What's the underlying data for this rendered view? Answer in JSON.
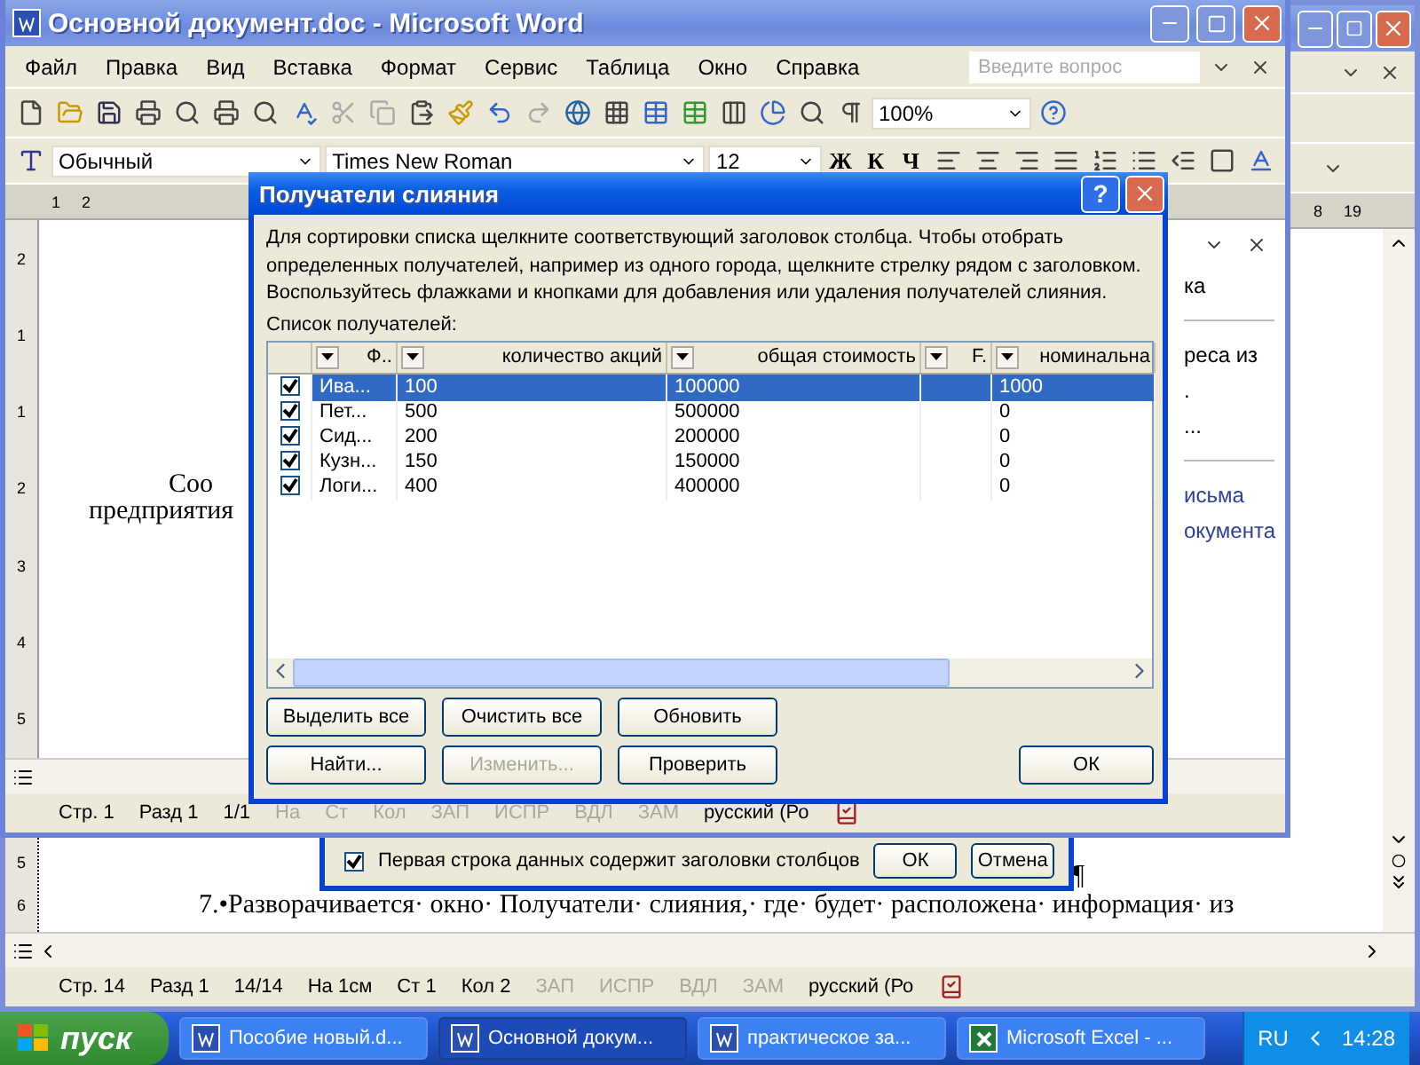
{
  "back_window": {
    "ruler_numbers": [
      "8",
      "19"
    ],
    "vruler_numbers": [
      "5",
      "6"
    ],
    "pilcrow": "¶",
    "paragraph": "7.•Разворачивается· окно· Получатели· слияния,· где· будет· расположена· информация· из",
    "status_bar": [
      {
        "text": "Стр. 14",
        "disabled": false
      },
      {
        "text": "Разд 1",
        "disabled": false
      },
      {
        "text": "14/14",
        "disabled": false
      },
      {
        "text": "На 1см",
        "disabled": false
      },
      {
        "text": "Ст 1",
        "disabled": false
      },
      {
        "text": "Кол 2",
        "disabled": false
      },
      {
        "text": "ЗАП",
        "disabled": true
      },
      {
        "text": "ИСПР",
        "disabled": true
      },
      {
        "text": "ВДЛ",
        "disabled": true
      },
      {
        "text": "ЗАМ",
        "disabled": true
      },
      {
        "text": "русский (Ро",
        "disabled": false
      }
    ]
  },
  "back_dialog": {
    "checkbox_label": "Первая строка данных содержит заголовки столбцов",
    "checked": true,
    "buttons": [
      "ОК",
      "Отмена"
    ]
  },
  "window": {
    "title": "Основной документ.doc - Microsoft Word",
    "menu": [
      "Файл",
      "Правка",
      "Вид",
      "Вставка",
      "Формат",
      "Сервис",
      "Таблица",
      "Окно",
      "Справка"
    ],
    "help_placeholder": "Введите вопрос",
    "zoom": "100%",
    "style": "Обычный",
    "font": "Times New Roman",
    "size": "12",
    "format_buttons": [
      "Ж",
      "К",
      "Ч"
    ],
    "ruler_numbers": [
      "1",
      "2"
    ],
    "vruler_numbers": [
      "2",
      "1",
      "1",
      "2",
      "3",
      "4",
      "5"
    ],
    "document_lines": [
      "Соо",
      "предприятия"
    ],
    "task_pane": [
      {
        "text": "ка",
        "kind": "text"
      },
      {
        "kind": "separator"
      },
      {
        "text": "реса из",
        "kind": "text"
      },
      {
        "text": ".",
        "kind": "text"
      },
      {
        "text": "...",
        "kind": "text"
      },
      {
        "kind": "separator"
      },
      {
        "text": "исьма",
        "kind": "link"
      },
      {
        "text": "окумента",
        "kind": "link"
      }
    ],
    "status_bar": [
      {
        "text": "Стр. 1",
        "disabled": false
      },
      {
        "text": "Разд 1",
        "disabled": false
      },
      {
        "text": "1/1",
        "disabled": false
      },
      {
        "text": "На",
        "disabled": true
      },
      {
        "text": "Ст",
        "disabled": true
      },
      {
        "text": "Кол",
        "disabled": true
      },
      {
        "text": "ЗАП",
        "disabled": true
      },
      {
        "text": "ИСПР",
        "disabled": true
      },
      {
        "text": "ВДЛ",
        "disabled": true
      },
      {
        "text": "ЗАМ",
        "disabled": true
      },
      {
        "text": "русский (Ро",
        "disabled": false
      }
    ]
  },
  "dialog": {
    "title": "Получатели слияния",
    "help": "?",
    "description": "Для сортировки списка щелкните соответствующий заголовок столбца.  Чтобы отобрать определенных получателей, например из одного города, щелкните стрелку рядом с заголовком. Воспользуйтесь флажками и кнопками для добавления или удаления получателей слияния.",
    "list_label": "Список получателей:",
    "columns": [
      "Ф..",
      "количество акций",
      "общая стоимость",
      "F.",
      "номинальна"
    ],
    "rows": [
      {
        "checked": true,
        "selected": true,
        "cells": [
          "Ива...",
          "100",
          "100000",
          "",
          "1000"
        ]
      },
      {
        "checked": true,
        "selected": false,
        "cells": [
          "Пет...",
          "500",
          "500000",
          "",
          "0"
        ]
      },
      {
        "checked": true,
        "selected": false,
        "cells": [
          "Сид...",
          "200",
          "200000",
          "",
          "0"
        ]
      },
      {
        "checked": true,
        "selected": false,
        "cells": [
          "Кузн...",
          "150",
          "150000",
          "",
          "0"
        ]
      },
      {
        "checked": true,
        "selected": false,
        "cells": [
          "Логи...",
          "400",
          "400000",
          "",
          "0"
        ]
      }
    ],
    "buttons_row1": [
      {
        "label": "Выделить все",
        "disabled": false
      },
      {
        "label": "Очистить все",
        "disabled": false
      },
      {
        "label": "Обновить",
        "disabled": false
      }
    ],
    "buttons_row2": [
      {
        "label": "Найти...",
        "disabled": false
      },
      {
        "label": "Изменить...",
        "disabled": true
      },
      {
        "label": "Проверить",
        "disabled": false
      }
    ],
    "ok": "ОК"
  },
  "taskbar": {
    "start": "пуск",
    "tasks": [
      {
        "label": "Пособие новый.d...",
        "selected": false,
        "kind": "word"
      },
      {
        "label": "Основной докум...",
        "selected": true,
        "kind": "word"
      },
      {
        "label": "практическое за...",
        "selected": false,
        "kind": "word"
      },
      {
        "label": "Microsoft Excel - ...",
        "selected": false,
        "kind": "excel"
      }
    ],
    "language": "RU",
    "time": "14:28"
  }
}
